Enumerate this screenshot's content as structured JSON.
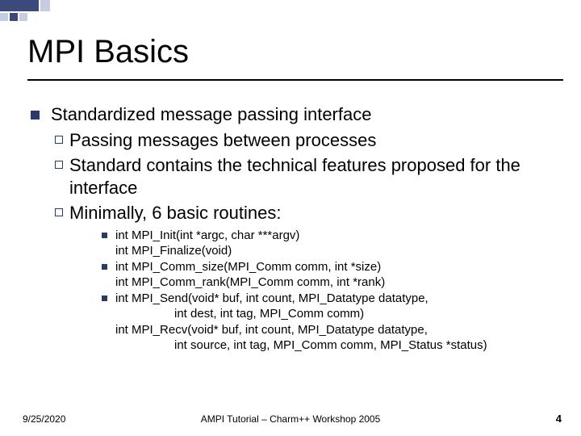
{
  "title": "MPI Basics",
  "lvl1": "Standardized message passing interface",
  "lvl2": [
    "Passing messages between processes",
    "Standard contains the technical features proposed for the interface",
    "Minimally, 6 basic routines:"
  ],
  "lvl3": [
    {
      "line": "int MPI_Init(int *argc, char ***argv)",
      "cont": [
        "int MPI_Finalize(void)"
      ]
    },
    {
      "line": "int MPI_Comm_size(MPI_Comm comm, int *size)",
      "cont": [
        "int MPI_Comm_rank(MPI_Comm comm, int *rank)"
      ]
    },
    {
      "line": "int MPI_Send(void* buf, int count, MPI_Datatype datatype,",
      "cont": [],
      "deep": [
        "int dest, int tag, MPI_Comm comm)"
      ],
      "cont2": [
        "int MPI_Recv(void* buf, int count, MPI_Datatype datatype,"
      ],
      "deep2": [
        "int source, int tag, MPI_Comm comm, MPI_Status *status)"
      ]
    }
  ],
  "footer": {
    "date": "9/25/2020",
    "center": "AMPI Tutorial – Charm++ Workshop 2005",
    "page": "4"
  }
}
